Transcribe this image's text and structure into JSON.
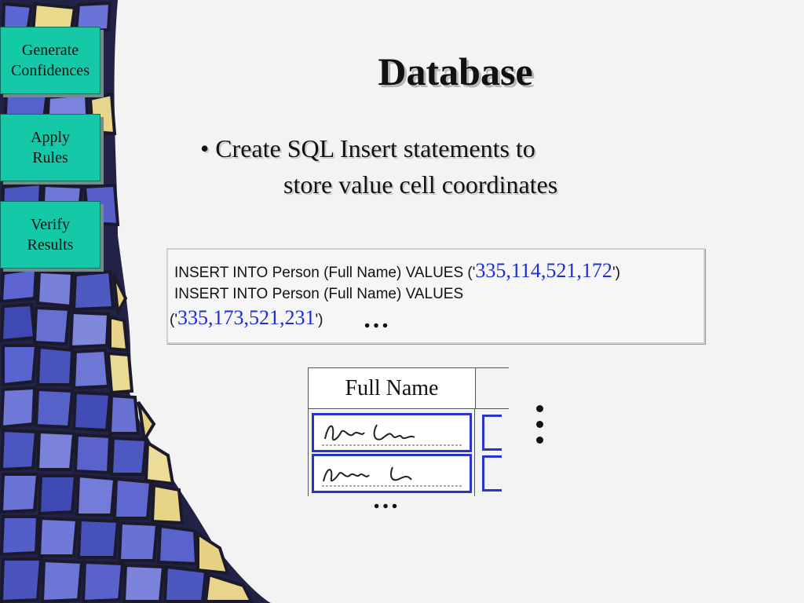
{
  "sidebar": {
    "items": [
      {
        "label": "Generate Confidences"
      },
      {
        "label": "Apply Rules"
      },
      {
        "label": "Verify Results"
      }
    ]
  },
  "slide": {
    "title": "Database",
    "bullet_line1": "• Create SQL Insert statements to",
    "bullet_line2": "store value cell coordinates"
  },
  "sql": {
    "line1_prefix": "INSERT INTO Person (Full Name) VALUES ('",
    "line1_coords": "335,114,521,172",
    "line1_suffix": "')",
    "line2": "INSERT INTO Person (Full Name) VALUES",
    "line3_prefix": "('",
    "line3_coords": "335,173,521,231",
    "line3_suffix": "')",
    "ellipsis": "…"
  },
  "table": {
    "header": "Full Name",
    "ellipsis": "…"
  },
  "colors": {
    "button_fill": "#14c8a8",
    "coordinate_text": "#1d2dd6",
    "cell_outline": "#2b34c8"
  }
}
